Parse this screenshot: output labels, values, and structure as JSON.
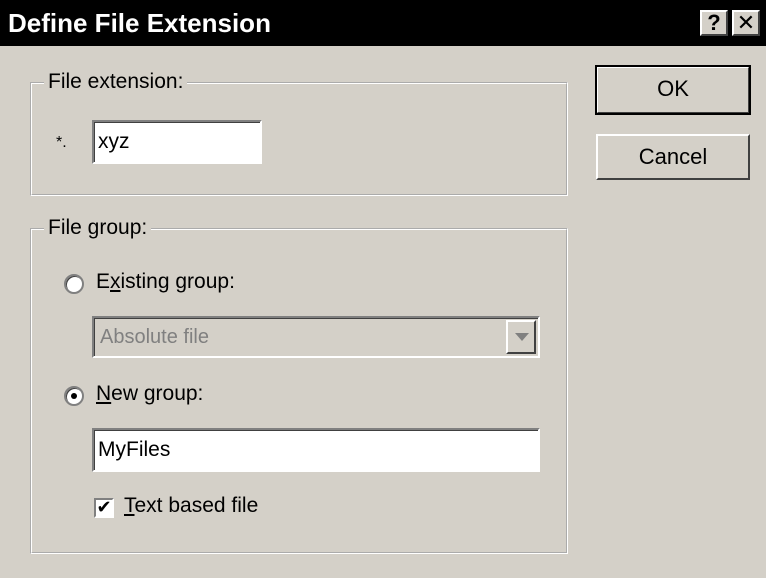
{
  "window": {
    "title": "Define File Extension",
    "help_label": "?",
    "close_label": "✕"
  },
  "extension": {
    "legend": "File extension:",
    "prefix": "*.",
    "value": "xyz"
  },
  "group": {
    "legend": "File group:",
    "existing": {
      "accel": "x",
      "label_pre": "E",
      "label_post": "isting group:",
      "checked": false,
      "selected_value": "Absolute file"
    },
    "new": {
      "accel": "N",
      "label_post": "ew group:",
      "checked": true,
      "value": "MyFiles"
    },
    "text_based": {
      "accel": "T",
      "label_post": "ext based file",
      "checked": true,
      "check_glyph": "✔"
    }
  },
  "buttons": {
    "ok": "OK",
    "cancel": "Cancel"
  }
}
